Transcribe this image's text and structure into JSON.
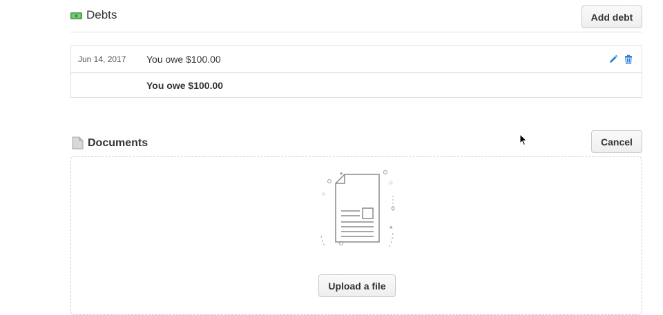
{
  "debts": {
    "title": "Debts",
    "add_button": "Add debt",
    "rows": [
      {
        "date": "Jun 14, 2017",
        "description": "You owe $100.00"
      }
    ],
    "total": "You owe $100.00"
  },
  "documents": {
    "title": "Documents",
    "cancel_button": "Cancel",
    "upload_button": "Upload a file"
  },
  "colors": {
    "money_green": "#4caf50",
    "action_blue": "#2f7fd4"
  }
}
